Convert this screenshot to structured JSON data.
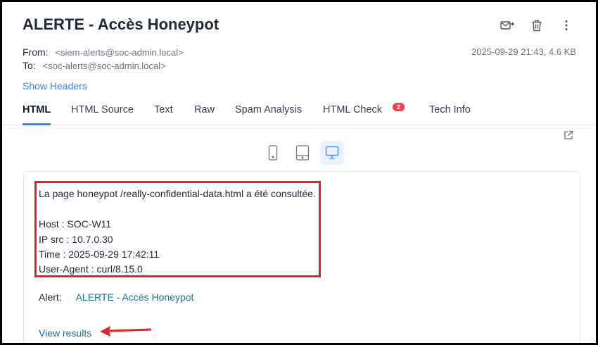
{
  "email": {
    "subject": "ALERTE - Accès Honeypot",
    "from_label": "From:",
    "from_addr": "<siem-alerts@soc-admin.local>",
    "to_label": "To:",
    "to_addr": "<soc-alerts@soc-admin.local>",
    "date_size": "2025-09-29 21:43, 4.6 KB",
    "show_headers": "Show Headers"
  },
  "toolbar": {
    "icons": [
      "mail-forward-icon",
      "trash-icon",
      "more-vertical-icon"
    ]
  },
  "tabs": [
    {
      "label": "HTML",
      "active": true
    },
    {
      "label": "HTML Source"
    },
    {
      "label": "Text"
    },
    {
      "label": "Raw"
    },
    {
      "label": "Spam Analysis"
    },
    {
      "label": "HTML Check",
      "badge": "2"
    },
    {
      "label": "Tech Info"
    }
  ],
  "devices": [
    "phone-icon",
    "tablet-icon",
    "desktop-icon"
  ],
  "active_device": "desktop",
  "body": {
    "line1": "La page honeypot /really-confidential-data.html a été consultée.",
    "host": "Host : SOC-W11",
    "ip": "IP src : 10.7.0.30",
    "time": "Time : 2025-09-29 17:42:11",
    "ua": "User-Agent : curl/8.15.0",
    "alert_label": "Alert:",
    "alert_value": "ALERTE - Accès Honeypot",
    "view_results": "View results"
  },
  "colors": {
    "accent": "#3b82f6",
    "link": "#1d6fa5",
    "highlight": "#dc2626",
    "badge": "#ef4444"
  }
}
